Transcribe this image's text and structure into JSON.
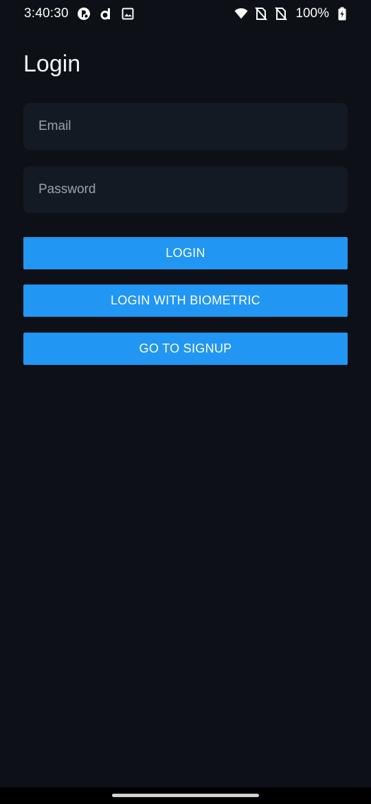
{
  "status_bar": {
    "time": "3:40:30",
    "battery": "100%",
    "icons": [
      "app-notification-icon",
      "d-app-icon",
      "image-icon",
      "wifi-icon",
      "no-sim-icon",
      "no-sim-icon",
      "battery-charging-icon"
    ]
  },
  "page": {
    "title": "Login"
  },
  "form": {
    "email_placeholder": "Email",
    "password_placeholder": "Password"
  },
  "buttons": {
    "login": "LOGIN",
    "biometric": "LOGIN WITH BIOMETRIC",
    "signup": "GO TO SIGNUP"
  },
  "colors": {
    "background": "#0d1016",
    "input_background": "#141a24",
    "accent": "#2196f3"
  }
}
